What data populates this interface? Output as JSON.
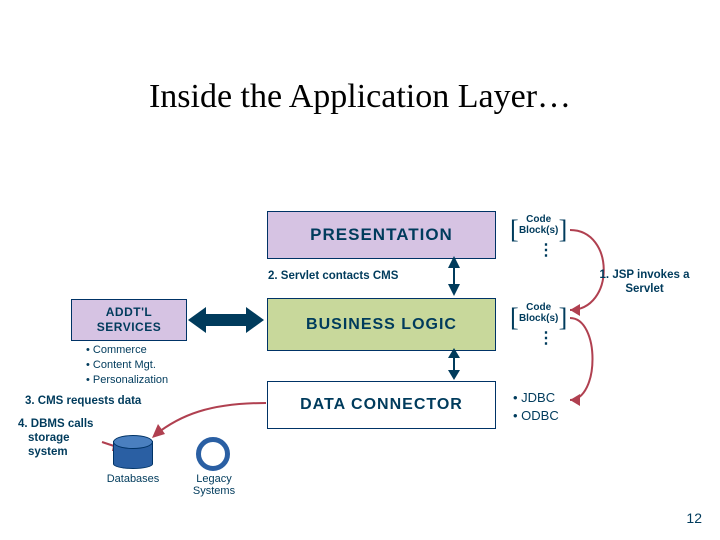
{
  "title": "Inside the Application Layer…",
  "blocks": {
    "presentation": "PRESENTATION",
    "business": "BUSINESS LOGIC",
    "data": "DATA CONNECTOR",
    "addt_line1": "ADDT'L",
    "addt_line2": "SERVICES"
  },
  "code_block_label": "Code Block(s)",
  "annotations": {
    "step1_line1": "1. JSP invokes a",
    "step1_line2": "Servlet",
    "step2": "2. Servlet contacts CMS",
    "step3": "3. CMS requests data",
    "step4_line1": "4. DBMS calls",
    "step4_line2": "storage",
    "step4_line3": "system"
  },
  "addt_bullets": [
    "Commerce",
    "Content Mgt.",
    "Personalization"
  ],
  "data_connectors": [
    "JDBC",
    "ODBC"
  ],
  "cylinders": {
    "db": "Databases",
    "legacy_line1": "Legacy",
    "legacy_line2": "Systems"
  },
  "slide_number": "12"
}
